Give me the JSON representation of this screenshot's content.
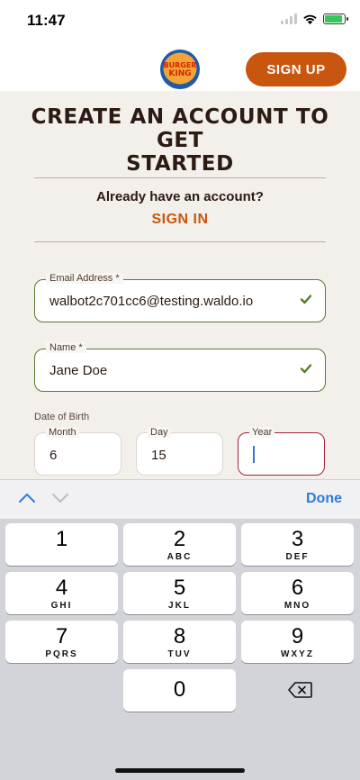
{
  "status_bar": {
    "time": "11:47"
  },
  "header": {
    "signup_label": "SIGN UP",
    "logo_text_1": "BURGER",
    "logo_text_2": "KING"
  },
  "form": {
    "title_line1": "CREATE AN ACCOUNT TO GET",
    "title_line2": "STARTED",
    "already_text": "Already have an account?",
    "signin_label": "SIGN IN",
    "email": {
      "label": "Email Address *",
      "value": "walbot2c701cc6@testing.waldo.io"
    },
    "name": {
      "label": "Name *",
      "value": "Jane Doe"
    },
    "dob_label": "Date of Birth",
    "month": {
      "label": "Month",
      "value": "6"
    },
    "day": {
      "label": "Day",
      "value": "15"
    },
    "year": {
      "label": "Year",
      "value": ""
    }
  },
  "keyboard": {
    "done_label": "Done",
    "keys": [
      {
        "num": "1",
        "letters": ""
      },
      {
        "num": "2",
        "letters": "ABC"
      },
      {
        "num": "3",
        "letters": "DEF"
      },
      {
        "num": "4",
        "letters": "GHI"
      },
      {
        "num": "5",
        "letters": "JKL"
      },
      {
        "num": "6",
        "letters": "MNO"
      },
      {
        "num": "7",
        "letters": "PQRS"
      },
      {
        "num": "8",
        "letters": "TUV"
      },
      {
        "num": "9",
        "letters": "WXYZ"
      },
      {
        "num": "0",
        "letters": ""
      }
    ]
  },
  "colors": {
    "brand_orange": "#c8560e",
    "valid_green": "#5a7a2a",
    "active_red": "#a3223a",
    "link_blue": "#2f7bdc"
  },
  "icons": [
    "wifi-icon",
    "battery-icon",
    "check-icon",
    "chevron-up-icon",
    "chevron-down-icon",
    "backspace-icon"
  ]
}
